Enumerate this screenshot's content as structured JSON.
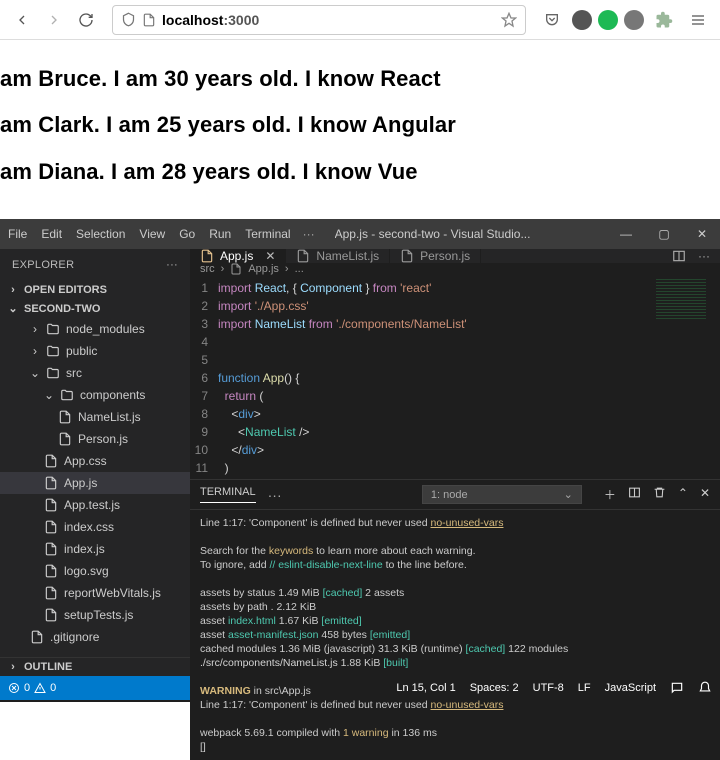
{
  "browser": {
    "url_prefix": "localhost",
    "url_rest": ":3000"
  },
  "page_lines": [
    "am Bruce. I am 30 years old. I know React",
    "am Clark. I am 25 years old. I know Angular",
    "am Diana. I am 28 years old. I know Vue"
  ],
  "vsc": {
    "menu": [
      "File",
      "Edit",
      "Selection",
      "View",
      "Go",
      "Run",
      "Terminal"
    ],
    "title": "App.js - second-two - Visual Studio...",
    "explorer": {
      "label": "EXPLORER",
      "open_editors": "OPEN EDITORS",
      "root": "SECOND-TWO",
      "outline": "OUTLINE"
    },
    "tree": [
      {
        "depth": 1,
        "kind": "folder",
        "open": false,
        "name": "node_modules"
      },
      {
        "depth": 1,
        "kind": "folder",
        "open": false,
        "name": "public"
      },
      {
        "depth": 1,
        "kind": "folder",
        "open": true,
        "name": "src"
      },
      {
        "depth": 2,
        "kind": "folder",
        "open": true,
        "name": "components"
      },
      {
        "depth": 3,
        "kind": "file",
        "name": "NameList.js"
      },
      {
        "depth": 3,
        "kind": "file",
        "name": "Person.js"
      },
      {
        "depth": 2,
        "kind": "file",
        "name": "App.css"
      },
      {
        "depth": 2,
        "kind": "file",
        "name": "App.js",
        "sel": true
      },
      {
        "depth": 2,
        "kind": "file",
        "name": "App.test.js"
      },
      {
        "depth": 2,
        "kind": "file",
        "name": "index.css"
      },
      {
        "depth": 2,
        "kind": "file",
        "name": "index.js"
      },
      {
        "depth": 2,
        "kind": "file",
        "name": "logo.svg"
      },
      {
        "depth": 2,
        "kind": "file",
        "name": "reportWebVitals.js"
      },
      {
        "depth": 2,
        "kind": "file",
        "name": "setupTests.js"
      },
      {
        "depth": 1,
        "kind": "file",
        "name": ".gitignore"
      }
    ],
    "tabs": [
      {
        "name": "App.js",
        "active": true,
        "close": true
      },
      {
        "name": "NameList.js",
        "active": false
      },
      {
        "name": "Person.js",
        "active": false
      }
    ],
    "breadcrumb": [
      "src",
      "App.js",
      "..."
    ],
    "code_lines": [
      {
        "n": 1,
        "html": "<span class='kw'>import</span> <span class='id'>React</span><span class='pl'>, { </span><span class='id'>Component</span><span class='pl'> } </span><span class='kw'>from</span> <span class='st'>'react'</span>"
      },
      {
        "n": 2,
        "html": "<span class='kw'>import</span> <span class='st'>'./App.css'</span>"
      },
      {
        "n": 3,
        "html": "<span class='kw'>import</span> <span class='id'>NameList</span> <span class='kw'>from</span> <span class='st'>'./components/NameList'</span>"
      },
      {
        "n": 4,
        "html": ""
      },
      {
        "n": 5,
        "html": ""
      },
      {
        "n": 6,
        "html": "<span class='bl'>function</span> <span class='fn'>App</span><span class='pl'>() {</span>"
      },
      {
        "n": 7,
        "html": "  <span class='kw'>return</span> <span class='pl'>(</span>"
      },
      {
        "n": 8,
        "html": "    <span class='pl'>&lt;</span><span class='bl'>div</span><span class='pl'>&gt;</span>"
      },
      {
        "n": 9,
        "html": "      <span class='pl'>&lt;</span><span class='tg'>NameList</span> <span class='pl'>/&gt;</span>"
      },
      {
        "n": 10,
        "html": "    <span class='pl'>&lt;/</span><span class='bl'>div</span><span class='pl'>&gt;</span>"
      },
      {
        "n": 11,
        "html": "  <span class='pl'>)</span>"
      }
    ],
    "panel": {
      "tab": "TERMINAL",
      "select": "1: node",
      "lines": [
        "  Line 1:17:  'Component' is defined but never used  <a class='ylink'>no-unused-vars</a>",
        "",
        "Search for the <span class='cyel'>keywords</span> to learn more about each warning.",
        "To ignore, add <span class='cgrn'>// eslint-disable-next-line</span> to the line before.",
        "",
        "assets by status 1.49 MiB <span class='cgrn'>[cached]</span> 2 assets",
        "assets by path <span class='pl'>.</span> 2.12 KiB",
        "  asset <span class='cgrn'>index.html</span> 1.67 KiB <span class='cgrn'>[emitted]</span>",
        "  asset <span class='cgrn'>asset-manifest.json</span> 458 bytes <span class='cgrn'>[emitted]</span>",
        "cached modules 1.36 MiB (javascript) 31.3 KiB (runtime) <span class='cgrn'>[cached]</span> 122 modules",
        "<span class='pl'>./src/components/NameList.js</span> 1.88 KiB <span class='cgrn'>[built]</span>",
        "",
        "<span class='cwarn'>WARNING</span> in src\\App.js",
        "  Line 1:17:  'Component' is defined but never used  <a class='ylink'>no-unused-vars</a>",
        "",
        "webpack 5.69.1 compiled with <span class='cyel'>1 warning</span> in 136 ms",
        "[]"
      ]
    },
    "status": {
      "errors": "0",
      "warnings": "0",
      "ln_col": "Ln 15, Col 1",
      "spaces": "Spaces: 2",
      "enc": "UTF-8",
      "eol": "LF",
      "lang": "JavaScript"
    }
  }
}
